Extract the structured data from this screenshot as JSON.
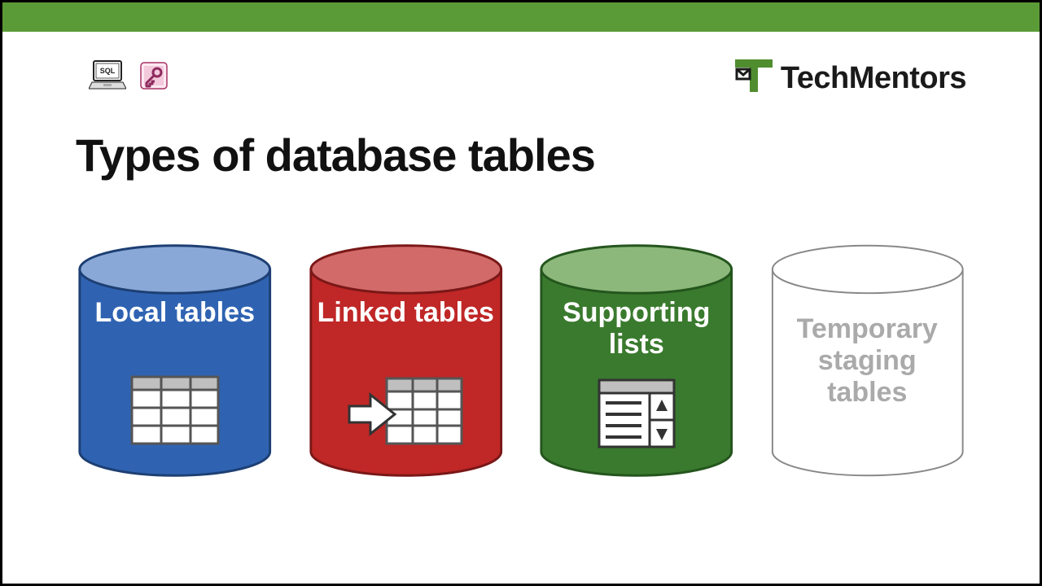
{
  "brand": {
    "name": "TechMentors"
  },
  "title": "Types of database tables",
  "header_icons": {
    "sql": "sql-laptop-icon",
    "access": "access-key-icon"
  },
  "cylinders": [
    {
      "label": "Local tables",
      "body_color": "#2f63b2",
      "top_color": "#8aa8d7",
      "stroke": "#1d3f73",
      "label_class": "white",
      "icon": "table-grid-icon"
    },
    {
      "label": "Linked tables",
      "body_color": "#c02727",
      "top_color": "#d26a6a",
      "stroke": "#7a1717",
      "label_class": "white",
      "icon": "linked-table-icon"
    },
    {
      "label": "Supporting lists",
      "body_color": "#3a7a2e",
      "top_color": "#8cb97b",
      "stroke": "#24551d",
      "label_class": "white",
      "icon": "list-picker-icon"
    },
    {
      "label": "Temporary staging tables",
      "body_color": "#ffffff",
      "top_color": "#ffffff",
      "stroke": "#888888",
      "label_class": "grey three",
      "icon": null
    }
  ]
}
